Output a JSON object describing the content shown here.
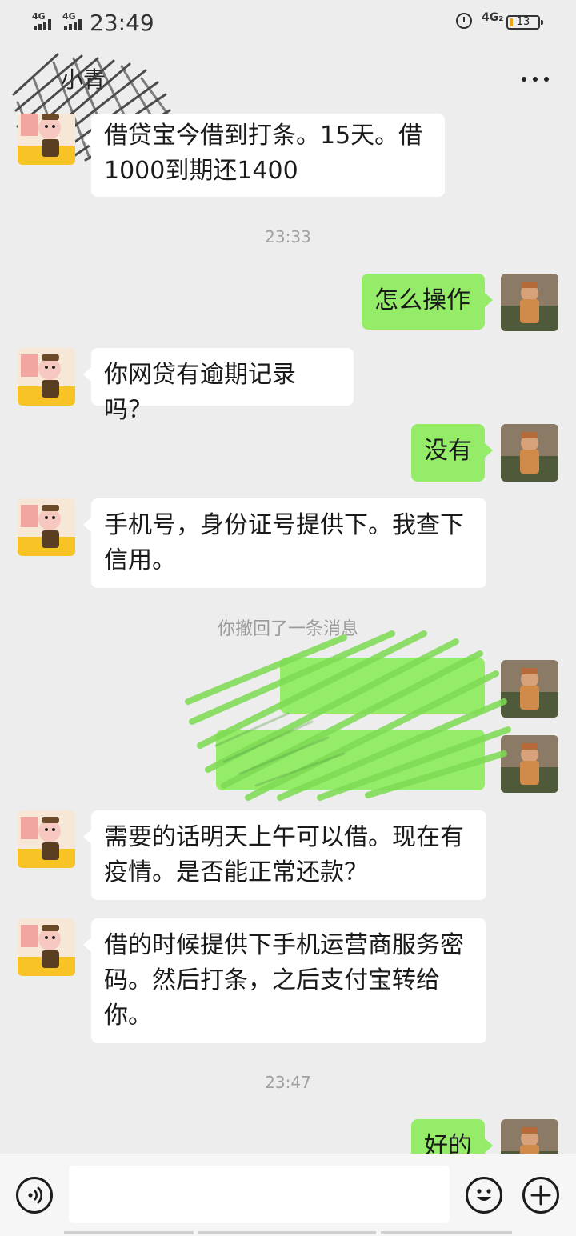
{
  "status_bar": {
    "signal1": "4G",
    "signal2": "4G",
    "time": "23:49",
    "network": "4G₂",
    "battery": "13",
    "battery_level": 0.13
  },
  "header": {
    "contact_name": "小青",
    "more": "···"
  },
  "messages": [
    {
      "type": "text",
      "side": "in",
      "text": "借贷宝今借到打条。15天。借1000到期还1400"
    },
    {
      "type": "time",
      "text": "23:33"
    },
    {
      "type": "text",
      "side": "out",
      "text": "怎么操作"
    },
    {
      "type": "text",
      "side": "in",
      "text": "你网贷有逾期记录吗？"
    },
    {
      "type": "text",
      "side": "out",
      "text": "没有"
    },
    {
      "type": "text",
      "side": "in",
      "text": "手机号，身份证号提供下。我查下信用。"
    },
    {
      "type": "system",
      "text": "你撤回了一条消息"
    },
    {
      "type": "text",
      "side": "in",
      "text": "需要的话明天上午可以借。现在有疫情。是否能正常还款？"
    },
    {
      "type": "text",
      "side": "in",
      "text": "借的时候提供下手机运营商服务密码。然后打条，之后支付宝转给你。"
    },
    {
      "type": "time",
      "text": "23:47"
    },
    {
      "type": "text",
      "side": "out",
      "text": "好的"
    }
  ],
  "input_bar": {
    "placeholder": ""
  },
  "icons": {
    "voice": "voice-icon",
    "emoji": "emoji-icon",
    "plus": "plus-icon",
    "more": "more-icon"
  },
  "colors": {
    "background": "#ededed",
    "bubble_out": "#95ec69",
    "bubble_in": "#ffffff",
    "battery": "#e8a80c"
  }
}
